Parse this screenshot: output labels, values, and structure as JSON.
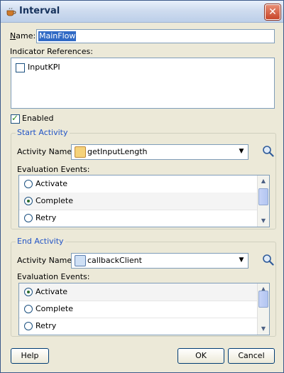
{
  "window": {
    "title": "Interval"
  },
  "name": {
    "label": "Name:",
    "value": "MainFlow"
  },
  "indicator": {
    "label": "Indicator References:",
    "items": [
      {
        "label": "InputKPI",
        "checked": false
      }
    ]
  },
  "enabled": {
    "label": "Enabled",
    "checked": true
  },
  "start_activity": {
    "group_title": "Start Activity",
    "activity_label": "Activity Name:",
    "activity_value": "getInputLength",
    "events_label": "Evaluation Events:",
    "events": [
      {
        "label": "Activate",
        "selected": false
      },
      {
        "label": "Complete",
        "selected": true
      },
      {
        "label": "Retry",
        "selected": false
      }
    ]
  },
  "end_activity": {
    "group_title": "End Activity",
    "activity_label": "Activity Name:",
    "activity_value": "callbackClient",
    "events_label": "Evaluation Events:",
    "events": [
      {
        "label": "Activate",
        "selected": true
      },
      {
        "label": "Complete",
        "selected": false
      },
      {
        "label": "Retry",
        "selected": false
      }
    ]
  },
  "buttons": {
    "help": "Help",
    "ok": "OK",
    "cancel": "Cancel"
  }
}
